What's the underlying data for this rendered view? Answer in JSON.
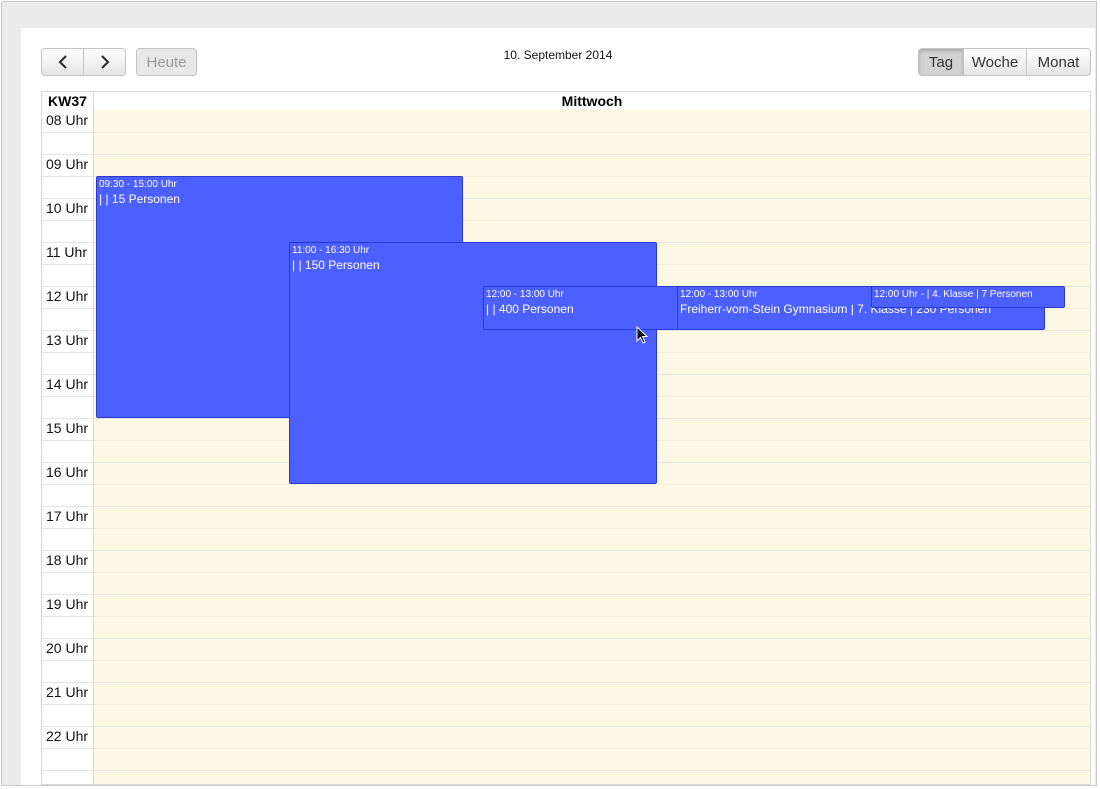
{
  "toolbar": {
    "prev_label": "‹",
    "next_label": "›",
    "today_label": "Heute",
    "date_title": "10. September 2014",
    "views": [
      {
        "label": "Tag",
        "active": true
      },
      {
        "label": "Woche",
        "active": false
      },
      {
        "label": "Monat",
        "active": false
      }
    ]
  },
  "calendar": {
    "week_label": "KW37",
    "day_label": "Mittwoch",
    "hours": [
      "08 Uhr",
      "09 Uhr",
      "10 Uhr",
      "11 Uhr",
      "12 Uhr",
      "13 Uhr",
      "14 Uhr",
      "15 Uhr",
      "16 Uhr",
      "17 Uhr",
      "18 Uhr",
      "19 Uhr",
      "20 Uhr",
      "21 Uhr",
      "22 Uhr"
    ],
    "events": [
      {
        "time": "09:30 - 15:00 Uhr",
        "title": "| | 15 Personen"
      },
      {
        "time": "11:00 - 16:30 Uhr",
        "title": "| | 150 Personen"
      },
      {
        "time": "12:00 - 13:00 Uhr",
        "title": "| | 400 Personen"
      },
      {
        "time": "12:00 - 13:00 Uhr",
        "title": "Freiherr-vom-Stein Gymnasium | 7. Klasse | 230 Personen"
      },
      {
        "time": "12:00 Uhr - | 4. Klasse | 7 Personen",
        "title": ""
      }
    ]
  },
  "colors": {
    "event": "#4c5fff",
    "day_background": "#fcf8e3"
  }
}
